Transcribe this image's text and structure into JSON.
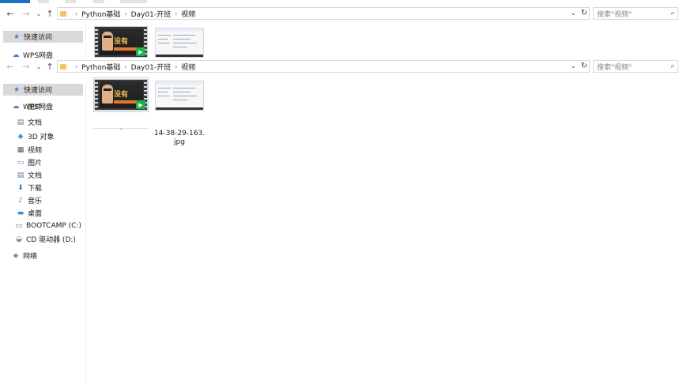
{
  "top_window": {
    "breadcrumbs": [
      "Python基础",
      "Day01-开班",
      "视频"
    ],
    "search_placeholder": "搜索\"视频\"",
    "nav": [
      {
        "label": "快速访问",
        "selected": true
      },
      {
        "label": "WPS网盘",
        "selected": false
      }
    ]
  },
  "window": {
    "breadcrumbs": [
      "Python基础",
      "Day01-开班",
      "视频"
    ],
    "search_placeholder": "搜索\"视频\"",
    "nav": [
      {
        "label": "快速访问",
        "icon": "star-icon",
        "selected": true
      },
      {
        "label": "WPS网盘",
        "icon": "cloud-icon"
      },
      {
        "label": "图片",
        "icon": "picture-icon"
      },
      {
        "label": "文档",
        "icon": "document-icon"
      },
      {
        "label": "3D 对象",
        "icon": "cube-icon"
      },
      {
        "label": "视频",
        "icon": "video-icon"
      },
      {
        "label": "图片",
        "icon": "picture-icon"
      },
      {
        "label": "文档",
        "icon": "document-icon"
      },
      {
        "label": "下载",
        "icon": "download-icon"
      },
      {
        "label": "音乐",
        "icon": "music-icon"
      },
      {
        "label": "桌面",
        "icon": "desktop-icon"
      },
      {
        "label": "BOOTCAMP (C:)",
        "icon": "drive-icon"
      },
      {
        "label": "CD 驱动器 (D:)",
        "icon": "cd-drive-icon"
      },
      {
        "label": "网络",
        "icon": "network-icon"
      }
    ],
    "files": [
      {
        "name": "",
        "type": "video"
      },
      {
        "name": "14-38-29-163.jpg",
        "type": "image"
      }
    ]
  },
  "colors": {
    "accent": "#1e6fc3",
    "selection": "#d9d9d9",
    "folder": "#f3c55a",
    "play_badge": "#1bb34a"
  }
}
